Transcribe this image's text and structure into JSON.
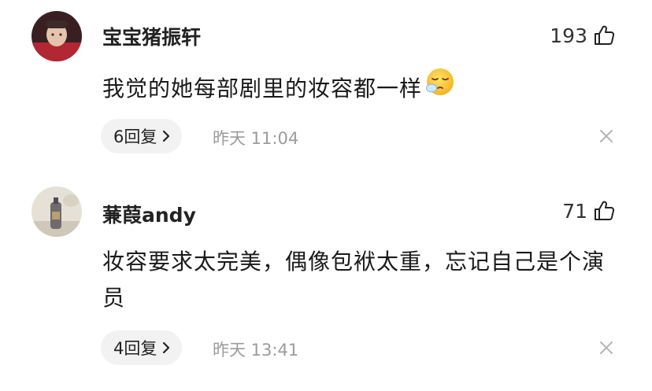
{
  "comments": [
    {
      "username": "宝宝猪振轩",
      "likes": "193",
      "text": "我觉的她每部剧里的妆容都一样",
      "reply_label": "6回复",
      "timestamp": "昨天 11:04",
      "emoji": "sleepy-face-emoji"
    },
    {
      "username": "蒹葭andy",
      "likes": "71",
      "text": "妆容要求太完美，偶像包袱太重，忘记自己是个演员",
      "reply_label": "4回复",
      "timestamp": "昨天 13:41"
    }
  ],
  "icons": {
    "like": "thumbs-up-icon",
    "chevron": "chevron-right-icon",
    "close": "close-icon"
  },
  "colors": {
    "pill_bg": "#f2f2f2",
    "timestamp": "#9b9b9b",
    "text": "#1a1a1a"
  }
}
